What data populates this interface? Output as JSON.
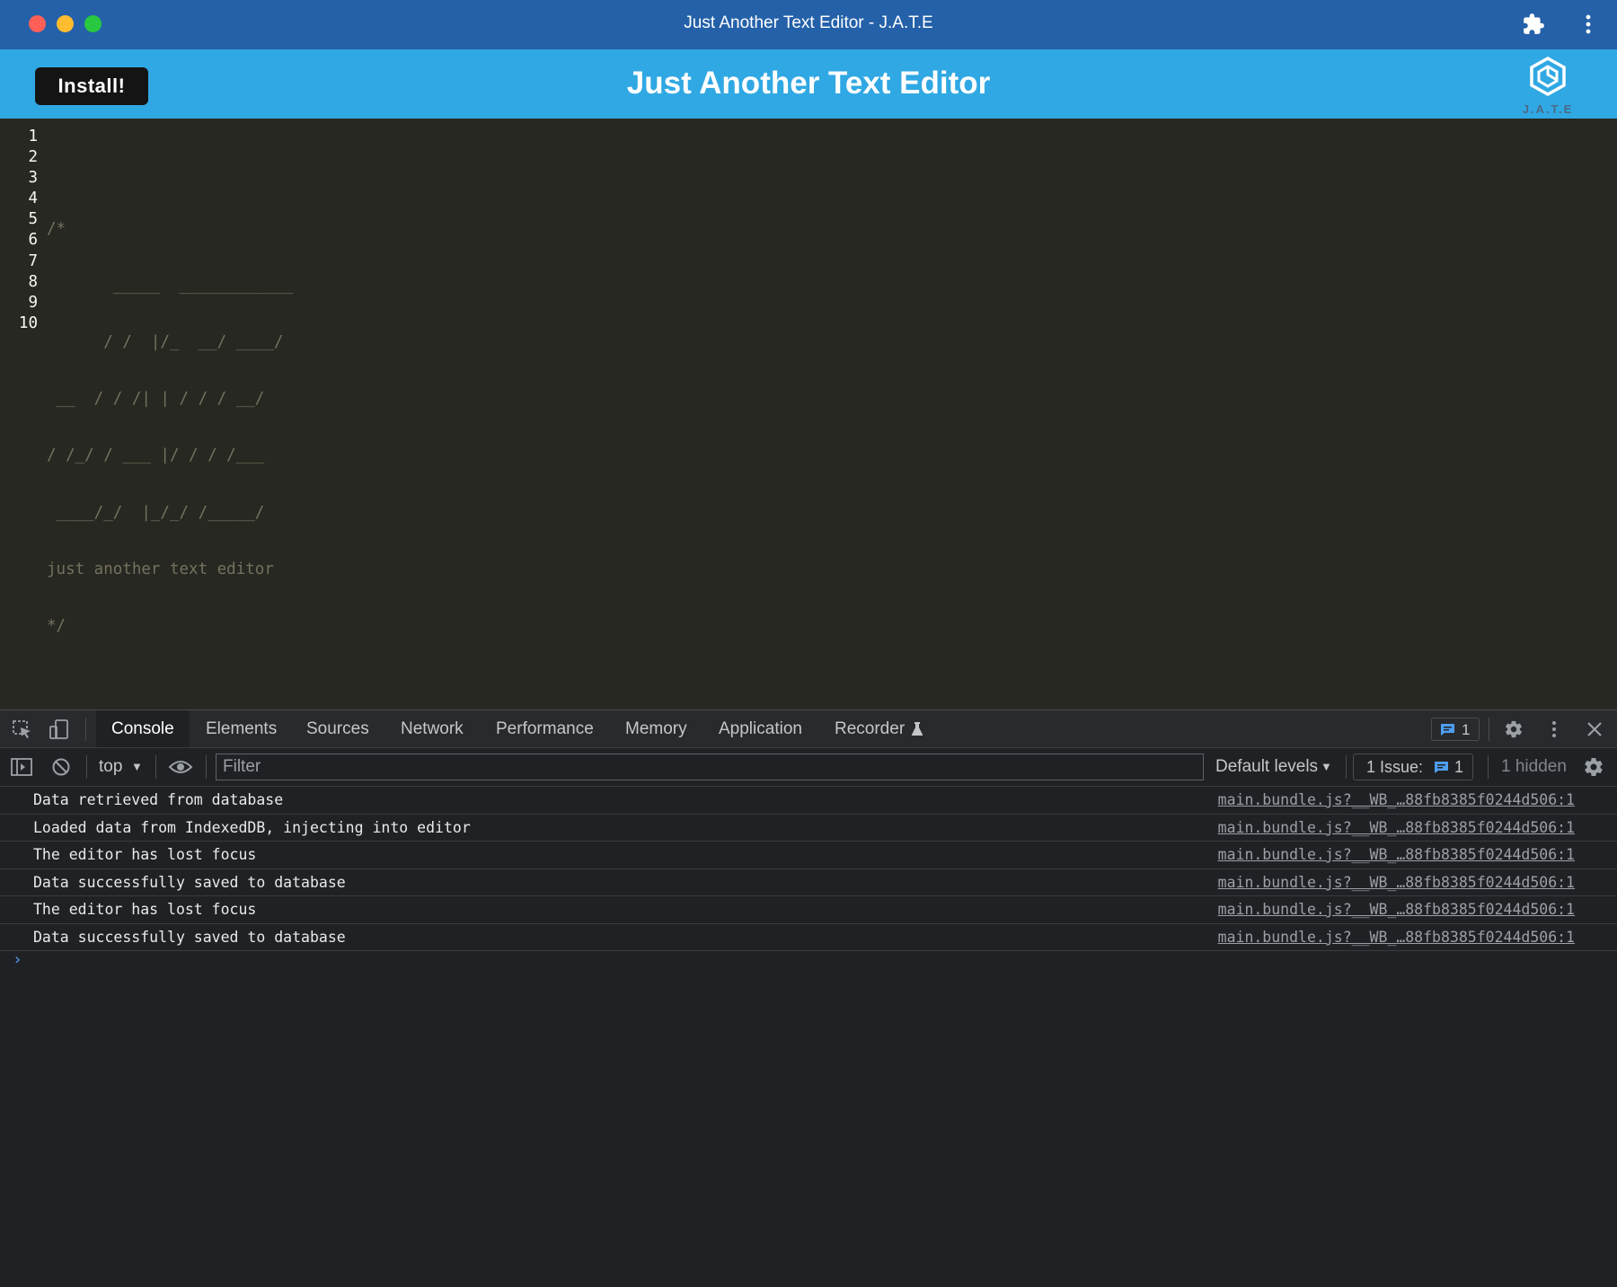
{
  "window": {
    "title": "Just Another Text Editor - J.A.T.E"
  },
  "header": {
    "install_label": "Install!",
    "title": "Just Another Text Editor",
    "logo_text": "J.A.T.E"
  },
  "editor": {
    "line_numbers": [
      "1",
      "2",
      "3",
      "4",
      "5",
      "6",
      "7",
      "8",
      "9",
      "10"
    ],
    "lines": [
      "",
      "/*",
      "       _____  ____________",
      "      / /  |/_  __/ ____/",
      " __  / / /| | / / / __/",
      "/ /_/ / ___ |/ / / /___",
      " ____/_/  |_/_/ /_____/",
      "just another text editor",
      "*/",
      ""
    ]
  },
  "devtools": {
    "tabs": [
      "Console",
      "Elements",
      "Sources",
      "Network",
      "Performance",
      "Memory",
      "Application",
      "Recorder"
    ],
    "messages_count": "1",
    "context": "top",
    "filter_placeholder": "Filter",
    "levels": "Default levels",
    "issues_label": "1 Issue:",
    "issues_count": "1",
    "hidden": "1 hidden",
    "console": [
      {
        "text": "Data retrieved from database",
        "source": "main.bundle.js?__WB_…88fb8385f0244d506:1"
      },
      {
        "text": "Loaded data from IndexedDB, injecting into editor",
        "source": "main.bundle.js?__WB_…88fb8385f0244d506:1"
      },
      {
        "text": "The editor has lost focus",
        "source": "main.bundle.js?__WB_…88fb8385f0244d506:1"
      },
      {
        "text": "Data successfully saved to database",
        "source": "main.bundle.js?__WB_…88fb8385f0244d506:1"
      },
      {
        "text": "The editor has lost focus",
        "source": "main.bundle.js?__WB_…88fb8385f0244d506:1"
      },
      {
        "text": "Data successfully saved to database",
        "source": "main.bundle.js?__WB_…88fb8385f0244d506:1"
      }
    ]
  },
  "colors": {
    "titlebar": "#2461a9",
    "appbar": "#30a8e3",
    "editor_bg": "#272822",
    "devtools_bg": "#202124"
  }
}
